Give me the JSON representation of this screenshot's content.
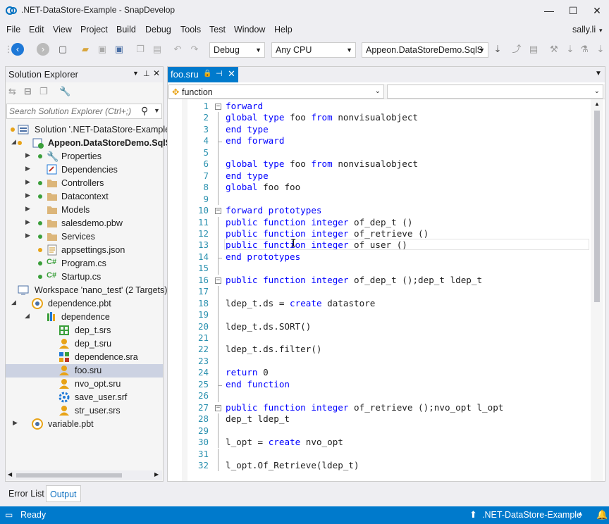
{
  "window": {
    "title": ".NET-DataStore-Example - SnapDevelop",
    "min": "—",
    "max": "☐",
    "close": "✕"
  },
  "menu": [
    "File",
    "Edit",
    "View",
    "Project",
    "Build",
    "Debug",
    "Tools",
    "Test",
    "Window",
    "Help"
  ],
  "user": "sally.li",
  "toolbar": {
    "config": "Debug",
    "platform": "Any CPU",
    "project": "Appeon.DataStoreDemo.SqlS"
  },
  "solution_explorer": {
    "title": "Solution Explorer",
    "search_placeholder": "Search Solution Explorer (Ctrl+;)",
    "items": [
      {
        "label": "Solution '.NET-DataStore-Example'",
        "icon": "solution-icon"
      },
      {
        "label": "Appeon.DataStoreDemo.SqlS",
        "icon": "project-icon"
      },
      {
        "label": "Properties",
        "icon": "wrench-icon"
      },
      {
        "label": "Dependencies",
        "icon": "dependencies-icon"
      },
      {
        "label": "Controllers",
        "icon": "folder-icon"
      },
      {
        "label": "Datacontext",
        "icon": "folder-icon"
      },
      {
        "label": "Models",
        "icon": "folder-icon"
      },
      {
        "label": "salesdemo.pbw",
        "icon": "folder-icon"
      },
      {
        "label": "Services",
        "icon": "folder-icon"
      },
      {
        "label": "appsettings.json",
        "icon": "json-icon"
      },
      {
        "label": "Program.cs",
        "icon": "csharp-icon"
      },
      {
        "label": "Startup.cs",
        "icon": "csharp-icon"
      },
      {
        "label": "Workspace 'nano_test' (2 Targets)",
        "icon": "workspace-icon"
      },
      {
        "label": "dependence.pbt",
        "icon": "target-icon"
      },
      {
        "label": "dependence",
        "icon": "library-icon"
      },
      {
        "label": "dep_t.srs",
        "icon": "structure-icon"
      },
      {
        "label": "dep_t.sru",
        "icon": "user-object-icon"
      },
      {
        "label": "dependence.sra",
        "icon": "application-icon"
      },
      {
        "label": "foo.sru",
        "icon": "user-object-icon"
      },
      {
        "label": "nvo_opt.sru",
        "icon": "user-object-icon"
      },
      {
        "label": "save_user.srf",
        "icon": "function-icon"
      },
      {
        "label": "str_user.srs",
        "icon": "user-object-icon"
      },
      {
        "label": "variable.pbt",
        "icon": "target-icon"
      }
    ]
  },
  "editor": {
    "tab": "foo.sru",
    "nav_left": "function",
    "nav_right": "",
    "lines": [
      "forward",
      "global type foo from nonvisualobject",
      "end type",
      "end forward",
      "",
      "global type foo from nonvisualobject",
      "end type",
      "global foo foo",
      "",
      "forward prototypes",
      "public function integer of_dep_t ()",
      "public function integer of_retrieve ()",
      "public function integer of_user ()",
      "end prototypes",
      "",
      "public function integer of_dep_t ();dep_t ldep_t",
      "",
      "ldep_t.ds = create datastore",
      "",
      "ldep_t.ds.SORT()",
      "",
      "ldep_t.ds.filter()",
      "",
      "return 0",
      "end function",
      "",
      "public function integer of_retrieve ();nvo_opt l_opt",
      "dep_t ldep_t",
      "",
      "l_opt = create nvo_opt",
      "",
      "l_opt.Of_Retrieve(ldep_t)"
    ]
  },
  "bottom_tabs": [
    "Error List",
    "Output"
  ],
  "status": {
    "left": "Ready",
    "right": ".NET-DataStore-Example"
  }
}
